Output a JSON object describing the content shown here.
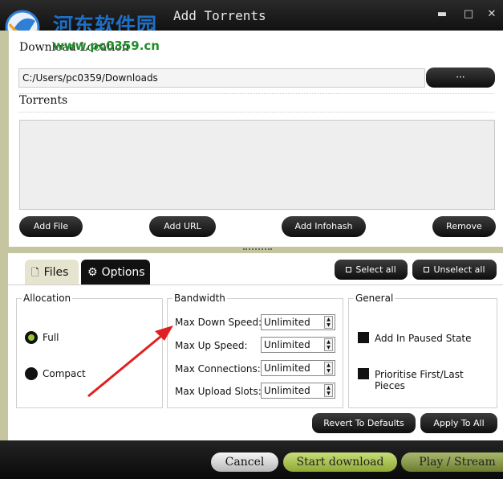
{
  "watermark": {
    "title": "河东软件园",
    "url": "www.pc0359.cn"
  },
  "window": {
    "title": "Add Torrents",
    "minimize": "▬",
    "maximize": "□",
    "close": "✕"
  },
  "download": {
    "label": "Download Location",
    "path": "C:/Users/pc0359/Downloads",
    "browse_label": "···"
  },
  "torrents": {
    "label": "Torrents",
    "buttons": {
      "add_file": "Add File",
      "add_url": "Add URL",
      "add_infohash": "Add Infohash",
      "remove": "Remove"
    }
  },
  "tabs": {
    "files": "Files",
    "options": "Options",
    "active": "Options"
  },
  "selection": {
    "select_all": "Select all",
    "unselect_all": "Unselect all"
  },
  "allocation": {
    "title": "Allocation",
    "options": [
      {
        "label": "Full",
        "selected": true
      },
      {
        "label": "Compact",
        "selected": false
      }
    ]
  },
  "bandwidth": {
    "title": "Bandwidth",
    "rows": [
      {
        "label": "Max Down Speed:",
        "value": "Unlimited"
      },
      {
        "label": "Max Up Speed:",
        "value": "Unlimited"
      },
      {
        "label": "Max Connections:",
        "value": "Unlimited"
      },
      {
        "label": "Max Upload Slots:",
        "value": "Unlimited"
      }
    ]
  },
  "general": {
    "title": "General",
    "checks": [
      {
        "label": "Add In Paused State",
        "checked": false
      },
      {
        "label": "Prioritise First/Last Pieces",
        "checked": false
      }
    ]
  },
  "option_buttons": {
    "revert": "Revert To Defaults",
    "apply_all": "Apply To All"
  },
  "footer": {
    "cancel": "Cancel",
    "start": "Start download",
    "play": "Play / Stream"
  },
  "colors": {
    "accent_green": "#9cc43a",
    "watermark_blue": "#1e6fc8",
    "watermark_green": "#1f8f28",
    "annotation_arrow": "#e02020"
  }
}
